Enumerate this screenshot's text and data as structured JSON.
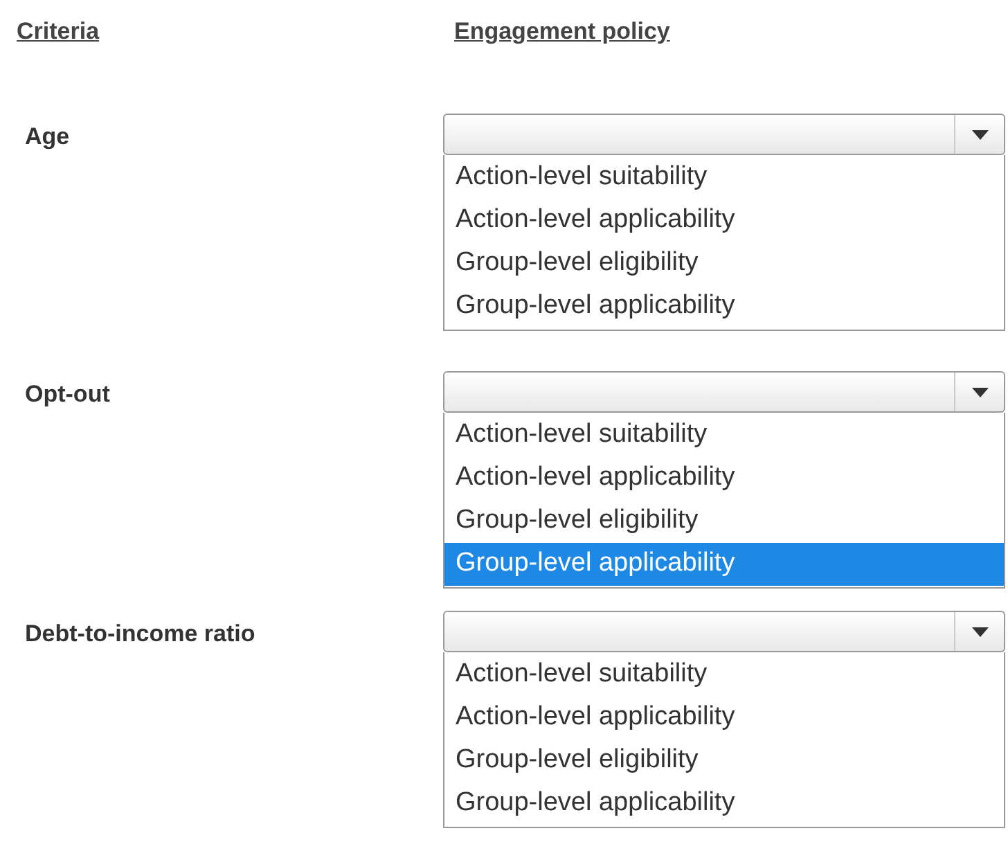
{
  "headers": [
    "Criteria",
    "Engagement policy"
  ],
  "rows": [
    {
      "label": "Age",
      "options": [
        {
          "text": "Action-level suitability",
          "selected": false
        },
        {
          "text": "Action-level applicability",
          "selected": false
        },
        {
          "text": "Group-level eligibility",
          "selected": false
        },
        {
          "text": "Group-level applicability",
          "selected": false
        }
      ]
    },
    {
      "label": "Opt-out",
      "options": [
        {
          "text": "Action-level suitability",
          "selected": false
        },
        {
          "text": "Action-level applicability",
          "selected": false
        },
        {
          "text": "Group-level eligibility",
          "selected": false
        },
        {
          "text": "Group-level applicability",
          "selected": true
        }
      ]
    },
    {
      "label": "Debt-to-income ratio",
      "options": [
        {
          "text": "Action-level suitability",
          "selected": false
        },
        {
          "text": "Action-level applicability",
          "selected": false
        },
        {
          "text": "Group-level eligibility",
          "selected": false
        },
        {
          "text": "Group-level applicability",
          "selected": false
        }
      ]
    }
  ]
}
